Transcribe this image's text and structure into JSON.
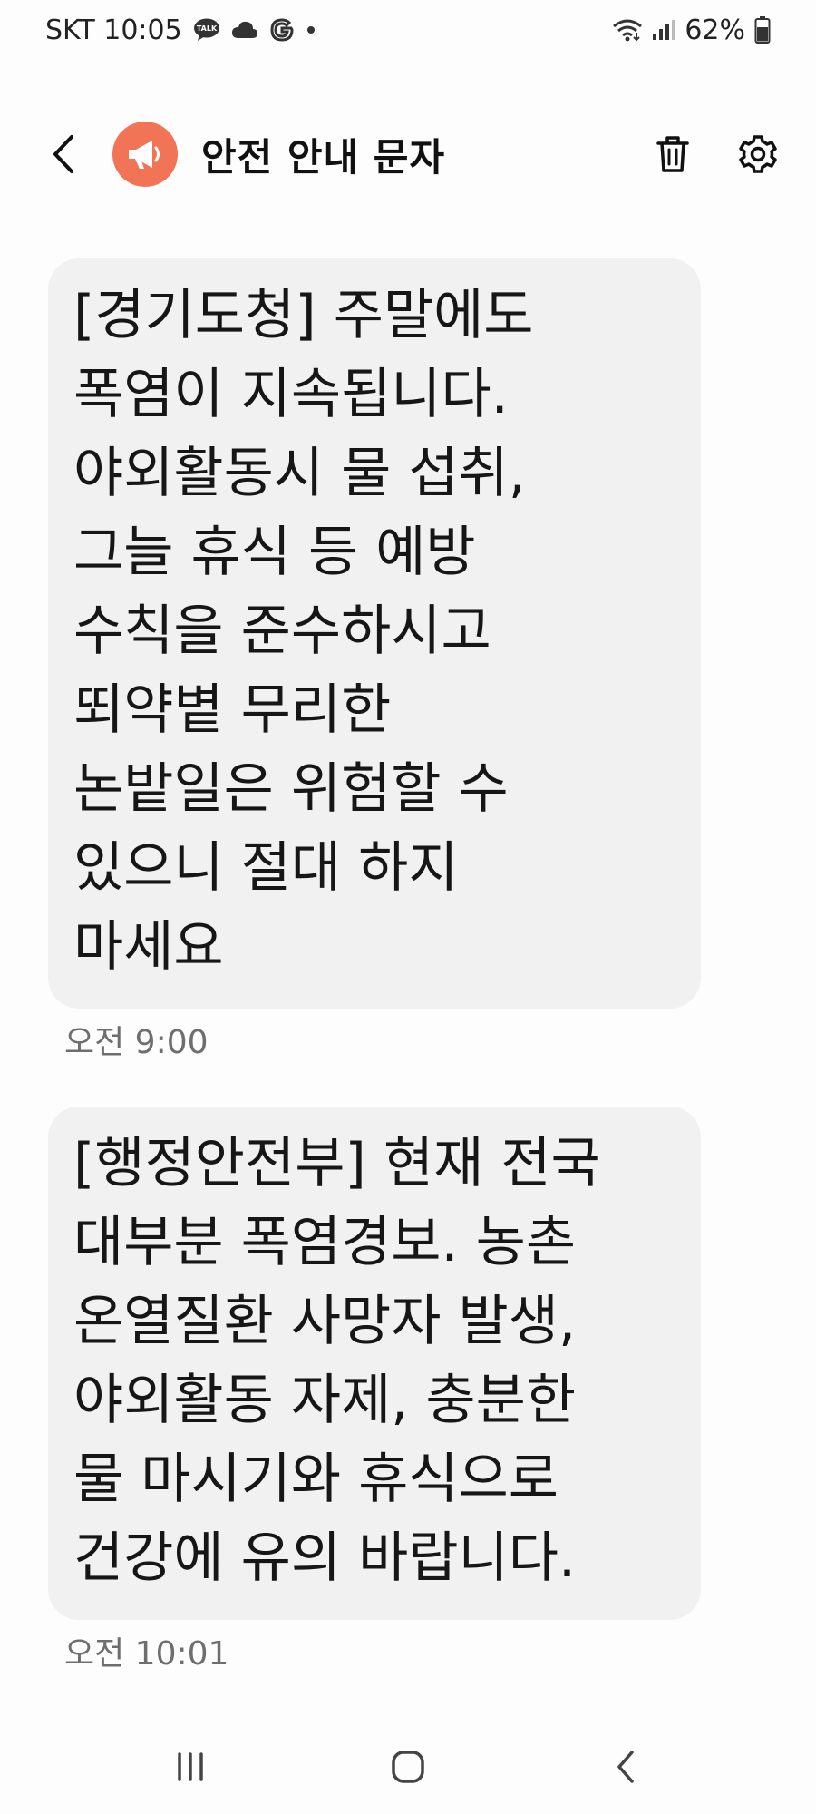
{
  "status_bar": {
    "carrier_time": "SKT 10:05",
    "battery_percent": "62%",
    "icons": [
      "talk-icon",
      "cloud-icon",
      "google-icon",
      "dot-icon",
      "wifi-icon",
      "signal-icon",
      "battery-icon"
    ]
  },
  "header": {
    "title": "안전 안내 문자",
    "avatar_icon": "megaphone-icon",
    "avatar_color": "#f27457",
    "actions": [
      "trash-icon",
      "settings-icon"
    ]
  },
  "messages": [
    {
      "text": "[경기도청] 주말에도\n폭염이 지속됩니다.\n야외활동시 물 섭취,\n그늘 휴식 등 예방\n수칙을 준수하시고\n뙤약볕 무리한\n논밭일은 위험할 수\n있으니 절대 하지\n마세요",
      "time": "오전 9:00"
    },
    {
      "text": "[행정안전부] 현재 전국\n대부분 폭염경보. 농촌\n온열질환 사망자 발생,\n야외활동 자제, 충분한\n물 마시기와 휴식으로\n건강에 유의 바랍니다.",
      "time": "오전 10:01"
    }
  ],
  "nav_bar": {
    "buttons": [
      "recent-apps-icon",
      "home-icon",
      "back-icon"
    ]
  }
}
